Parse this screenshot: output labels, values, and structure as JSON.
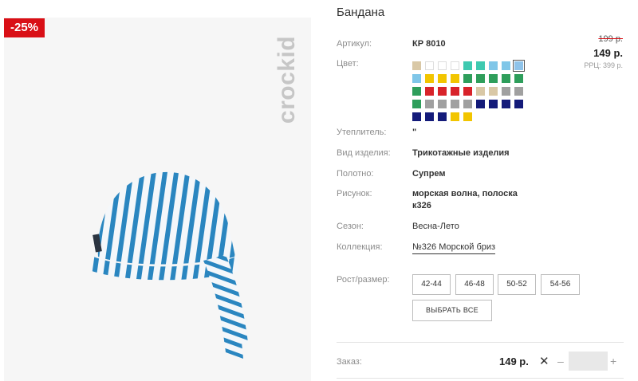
{
  "badge": {
    "discount": "-25%"
  },
  "brand": {
    "logo_text": "crockid"
  },
  "product": {
    "title": "Бандана",
    "article_label": "Артикул:",
    "article": "КР 8010",
    "color_label": "Цвет:",
    "insulation_label": "Утеплитель:",
    "insulation": "\"",
    "type_label": "Вид изделия:",
    "type": "Трикотажные изделия",
    "fabric_label": "Полотно:",
    "fabric": "Супрем",
    "pattern_label": "Рисунок:",
    "pattern_line1": "морская волна, полоска",
    "pattern_line2": "к326",
    "season_label": "Сезон:",
    "season": "Весна-Лето",
    "collection_label": "Коллекция:",
    "collection": "№326 Морской бриз",
    "size_label": "Рост/размер:"
  },
  "price": {
    "old": "199 р.",
    "new": "149 р.",
    "rrc": "РРЦ: 399 р."
  },
  "swatch_rows": [
    [
      "#d9c8a6",
      "#ffffff",
      "#ffffff",
      "#ffffff",
      "#3ec9b0",
      "#3ec9b0",
      "#7fc6e8",
      "#7fc6e8",
      "#8ec3ea"
    ],
    [
      "#7fc6e8",
      "#f2c500",
      "#f2c500",
      "#f2c500",
      "#2e9e5b",
      "#2e9e5b",
      "#2e9e5b",
      "#2e9e5b",
      "#2e9e5b"
    ],
    [
      "#2e9e5b",
      "#d8232a",
      "#d8232a",
      "#d8232a",
      "#d8232a",
      "#d9c8a6",
      "#d9c8a6",
      "#a0a0a0",
      "#a0a0a0"
    ],
    [
      "#2e9e5b",
      "#a0a0a0",
      "#a0a0a0",
      "#a0a0a0",
      "#a0a0a0",
      "#141b7a",
      "#141b7a",
      "#141b7a",
      "#141b7a"
    ],
    [
      "#141b7a",
      "#141b7a",
      "#141b7a",
      "#f2c500",
      "#f2c500"
    ]
  ],
  "sizes": [
    "42-44",
    "46-48",
    "50-52",
    "54-56"
  ],
  "select_all": "ВЫБРАТЬ ВСЕ",
  "order": {
    "label": "Заказ:",
    "price": "149 р.",
    "remove": "✕",
    "minus": "–",
    "plus": "+",
    "quantity": ""
  }
}
